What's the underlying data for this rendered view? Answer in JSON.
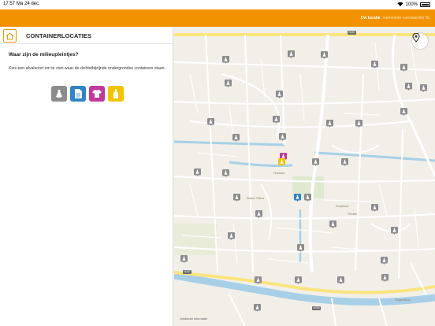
{
  "status_bar": {
    "time": "17:57",
    "date": "Ma 24 dec.",
    "battery": "100%"
  },
  "header": {
    "user_label": "Uw locatie",
    "user_value": "Gemeente Leeuwarden NL"
  },
  "panel": {
    "title": "CONTAINERLOCATIES",
    "question": "Waar zijn de milieupleintjes?",
    "description": "Kies een afvalsoort om te zien waar de dichtstbijzijnde ondergrondse containers staan.",
    "waste_types": [
      {
        "icon": "trash-bag-icon",
        "color": "#8c8c8c"
      },
      {
        "icon": "paper-icon",
        "color": "#2f83c6"
      },
      {
        "icon": "tshirt-icon",
        "color": "#c2389c"
      },
      {
        "icon": "bottle-icon",
        "color": "#f2c500"
      }
    ]
  },
  "map": {
    "labels": {
      "school": "Hoekstra",
      "station": "Station Stiens",
      "church": "Dorpskerk",
      "theatre": "Theater",
      "care": "Zorgcentrum",
      "credit": "Juridische informatie"
    },
    "road_numbers": [
      "N357",
      "N357",
      "N355"
    ],
    "colors": {
      "water": "#a7d0e8",
      "road_major": "#fbe47e",
      "road_minor": "#ffffff",
      "park": "#cfe8b8",
      "pin_grey": "#8c8c8c",
      "pin_blue": "#2f83c6",
      "pin_purple": "#c2389c",
      "pin_yellow": "#f2c500"
    }
  }
}
